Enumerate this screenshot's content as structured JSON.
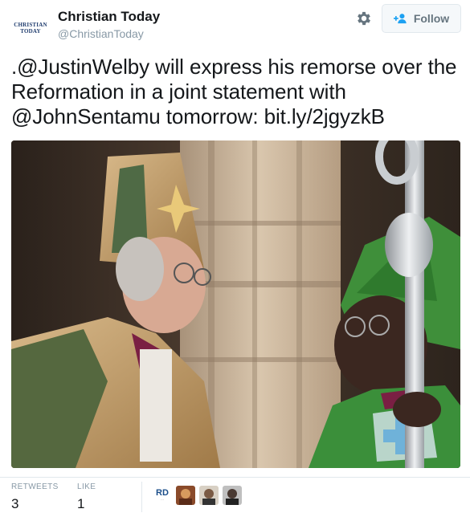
{
  "account": {
    "display_name": "Christian Today",
    "screen_name": "@ChristianToday",
    "avatar_line1": "CHRISTIAN",
    "avatar_line2": "TODAY"
  },
  "follow_button": {
    "label": "Follow"
  },
  "tweet": {
    "prefix": ".",
    "mention1": "@JustinWelby",
    "text1": " will express his remorse over the Reformation in a joint statement with ",
    "mention2": "@JohnSentamu",
    "text2": " tomorrow: ",
    "link": "bit.ly/2jgyzkB"
  },
  "stats": {
    "retweets_label": "RETWEETS",
    "retweets_value": "3",
    "likes_label": "LIKE",
    "likes_value": "1"
  },
  "likers": {
    "first_logo_text": "RD"
  },
  "colors": {
    "text": "#14171a",
    "muted": "#8899a6",
    "border": "#e1e8ed",
    "button_bg": "#f5f8fa"
  }
}
